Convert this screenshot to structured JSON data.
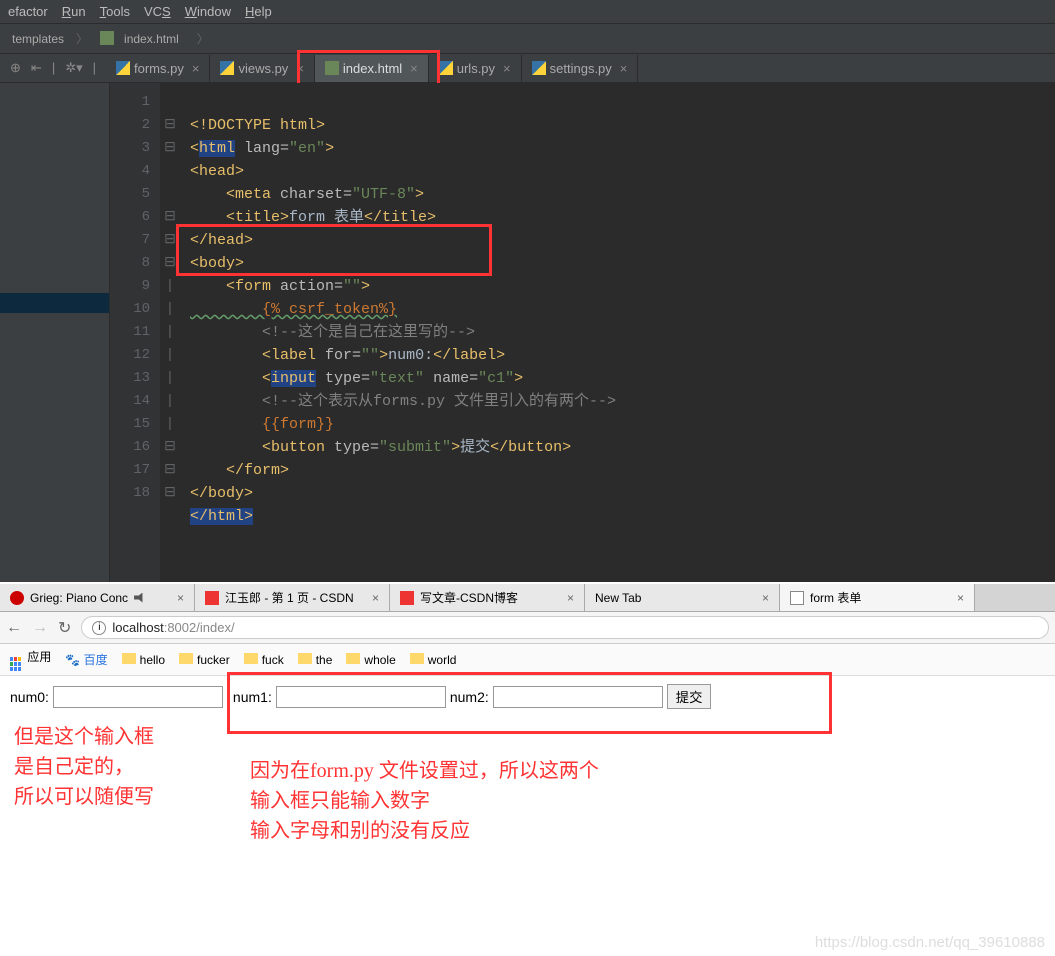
{
  "ide": {
    "menu": [
      "efactor",
      "Run",
      "Tools",
      "VCS",
      "Window",
      "Help"
    ],
    "breadcrumb": [
      "templates",
      "index.html"
    ],
    "tabs": [
      {
        "label": "forms.py",
        "type": "py"
      },
      {
        "label": "views.py",
        "type": "py"
      },
      {
        "label": "index.html",
        "type": "html",
        "active": true
      },
      {
        "label": "urls.py",
        "type": "py"
      },
      {
        "label": "settings.py",
        "type": "py"
      }
    ],
    "code_lines": 18,
    "code": {
      "l1": "<!DOCTYPE html>",
      "l2a": "<",
      "l2b": "html",
      "l2c": " lang=",
      "l2d": "\"en\"",
      "l2e": ">",
      "l3": "<head>",
      "l4a": "    <meta ",
      "l4b": "charset=",
      "l4c": "\"UTF-8\"",
      "l4d": ">",
      "l5a": "    <title>",
      "l5b": "form 表单",
      "l5c": "</title>",
      "l6": "</head>",
      "l7": "<body>",
      "l8a": "    <form ",
      "l8b": "action=",
      "l8c": "\"\"",
      "l8d": ">",
      "l9": "        {% csrf_token%}",
      "l10a": "        <!--",
      "l10b": "这个是自己在这里写的",
      "l10c": "-->",
      "l11a": "        <label ",
      "l11b": "for=",
      "l11c": "\"\"",
      "l11d": ">",
      "l11e": "num0:",
      "l11f": "</label>",
      "l12a": "        <",
      "l12b": "input",
      "l12c": " type=",
      "l12d": "\"text\"",
      "l12e": " name=",
      "l12f": "\"c1\"",
      "l12g": ">",
      "l13a": "        <!--",
      "l13b": "这个表示从forms.py 文件里引入的有两个",
      "l13c": "-->",
      "l14": "        {{form}}",
      "l15a": "        <button ",
      "l15b": "type=",
      "l15c": "\"submit\"",
      "l15d": ">",
      "l15e": "提交",
      "l15f": "</button>",
      "l16": "    </form>",
      "l17": "</body>",
      "l18": "</html>"
    }
  },
  "browser": {
    "tabs": [
      {
        "label": "Grieg: Piano Conc",
        "icon": "red",
        "sound": true
      },
      {
        "label": "江玉郎 - 第 1 页 - CSDN",
        "icon": "csdn"
      },
      {
        "label": "写文章-CSDN博客",
        "icon": "csdn"
      },
      {
        "label": "New Tab",
        "icon": ""
      },
      {
        "label": "form 表单",
        "icon": "page",
        "active": true
      }
    ],
    "url": "localhost:8002/index/",
    "bookmarks": [
      "应用",
      "百度",
      "hello",
      "fucker",
      "fuck",
      "the",
      "whole",
      "world"
    ],
    "form": {
      "label0": "num0:",
      "label1": "num1:",
      "label2": "num2:",
      "submit": "提交"
    },
    "annotations": {
      "left1": "但是这个输入框",
      "left2": "是自己定的，",
      "left3": "所以可以随便写",
      "right1": "因为在form.py 文件设置过，所以这两个",
      "right2": "输入框只能输入数字",
      "right3": "输入字母和别的没有反应"
    },
    "watermark": "https://blog.csdn.net/qq_39610888"
  }
}
